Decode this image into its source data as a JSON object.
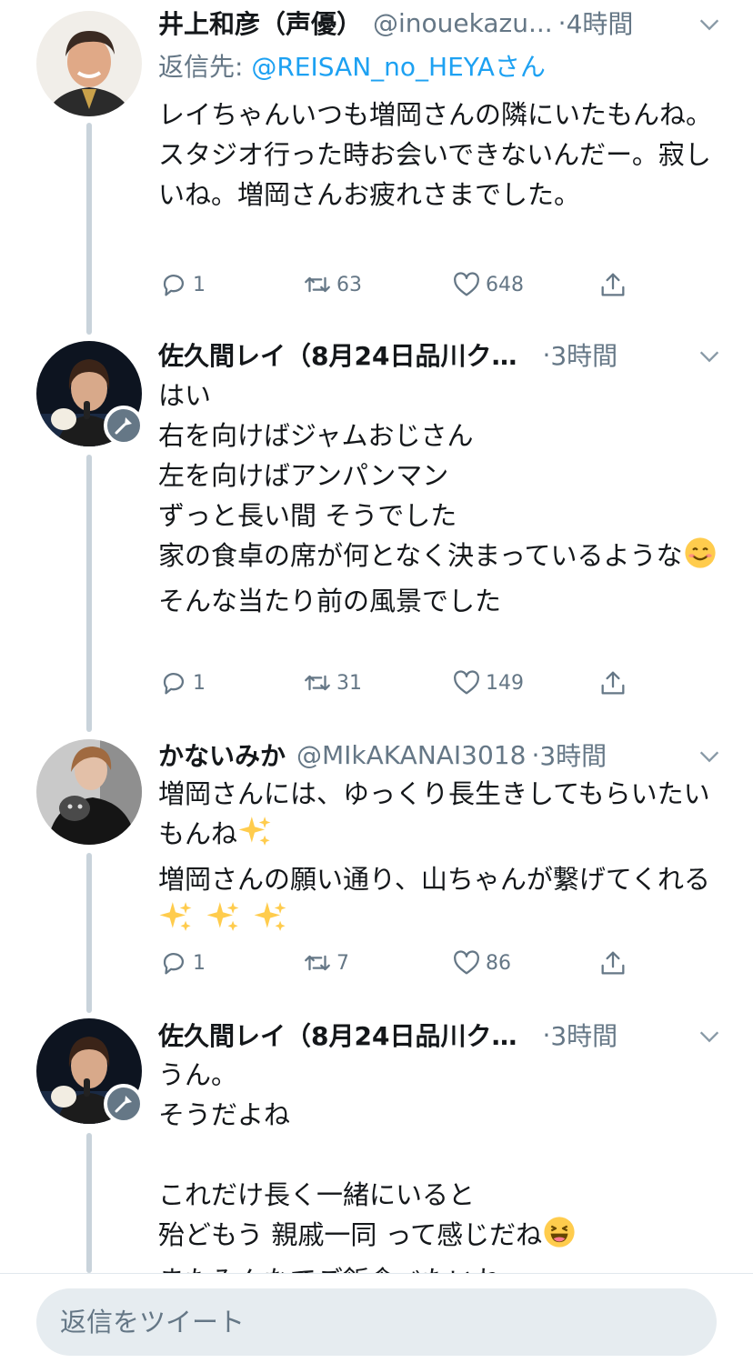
{
  "tweets": [
    {
      "name": "井上和彦（声優）",
      "handle": "@inouekazu...",
      "time": "4時間",
      "reply_label": "返信先: ",
      "reply_to": "@REISAN_no_HEYAさん",
      "text": "レイちゃんいつも増岡さんの隣にいたもんね。スタジオ行った時お会いできないんだー。寂しいね。増岡さんお疲れさまでした。",
      "replies": "1",
      "retweets": "63",
      "likes": "648"
    },
    {
      "name": "佐久間レイ（8月24日品川ク…",
      "handle": "",
      "time": "3時間",
      "text_lines": [
        "はい",
        "右を向けばジャムおじさん",
        "左を向けばアンパンマン",
        "ずっと長い間 そうでした",
        "家の食卓の席が何となく決まっているような",
        "そんな当たり前の風景でした"
      ],
      "emoji": "😊",
      "replies": "1",
      "retweets": "31",
      "likes": "149"
    },
    {
      "name": "かないみか",
      "handle": "@MIkAKANAI3018",
      "time": "3時間",
      "text_a": "増岡さんには、ゆっくり長生きしてもらいたいもんね",
      "text_b": "増岡さんの願い通り、山ちゃんが繋げてくれる",
      "emoji": "✨",
      "replies": "1",
      "retweets": "7",
      "likes": "86"
    },
    {
      "name": "佐久間レイ（8月24日品川ク…",
      "handle": "",
      "time": "3時間",
      "text_lines": [
        "うん。",
        "そうだよね",
        "",
        "これだけ長く一緒にいると",
        "殆どもう 親戚一同 って感じだね",
        "またみんなでご飯食べたいね"
      ],
      "emoji": "😆"
    }
  ],
  "compose": {
    "placeholder": "返信をツイート"
  },
  "icons": {
    "reply": "reply-icon",
    "retweet": "retweet-icon",
    "like": "heart-icon",
    "share": "share-icon",
    "caret": "chevron-down-icon",
    "mic": "microphone-icon"
  },
  "colors": {
    "text": "#14171a",
    "secondary": "#657786",
    "link": "#1da1f2",
    "thread_line": "#c9d3db",
    "compose_bg": "#e6ecf0"
  }
}
